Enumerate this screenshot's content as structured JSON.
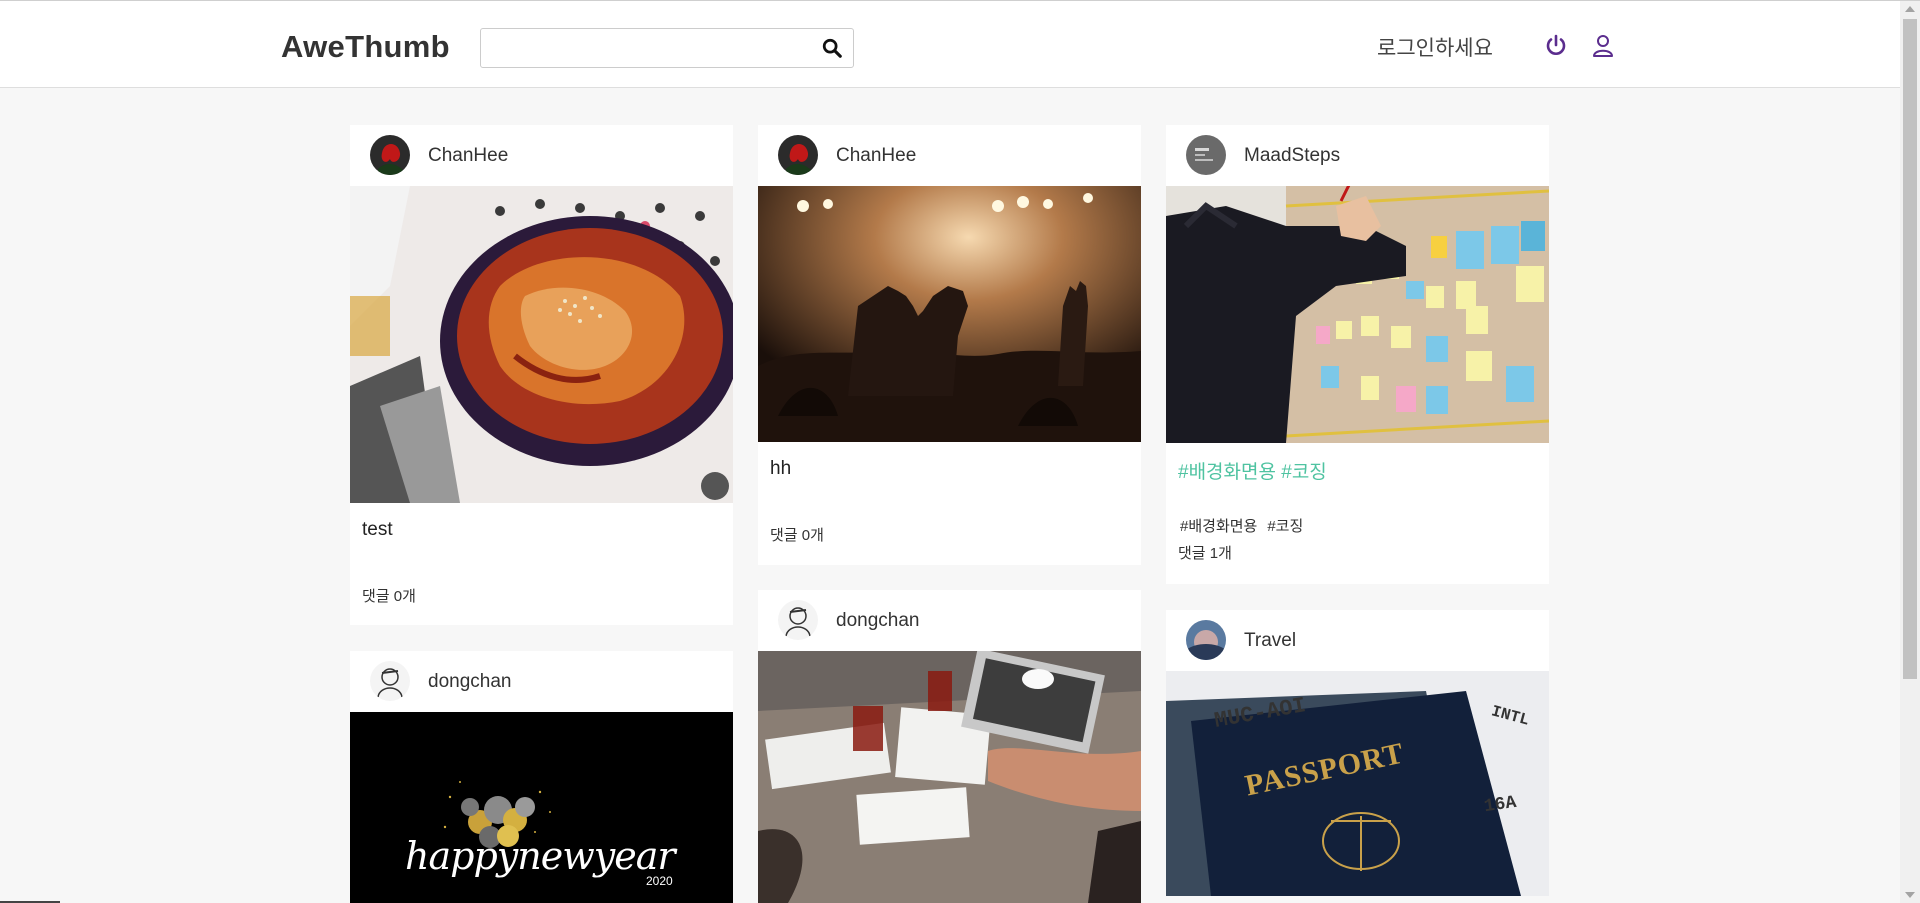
{
  "app": {
    "title": "AweThumb"
  },
  "header": {
    "search": {
      "value": "",
      "placeholder": ""
    },
    "login_text": "로그인하세요",
    "accent": "#5b2d8e"
  },
  "feed": {
    "col1": [
      {
        "username": "ChanHee",
        "caption": "test",
        "tags": [],
        "comments": "댓글 0개",
        "image": "food-bowl"
      },
      {
        "username": "dongchan",
        "caption": "",
        "tags": [],
        "comments": "",
        "image": "happy-new-year-2020",
        "image_text": "happynewyear",
        "image_year": "2020"
      }
    ],
    "col2": [
      {
        "username": "ChanHee",
        "caption": "hh",
        "tags": [],
        "comments": "댓글 0개",
        "image": "concert-crowd"
      },
      {
        "username": "dongchan",
        "caption": "",
        "tags": [],
        "comments": "",
        "image": "cafe-table"
      }
    ],
    "col3": [
      {
        "username": "MaadSteps",
        "caption": "#배경화면용 #코징",
        "tags": [
          "#배경화면용",
          "#코징"
        ],
        "comments": "댓글 1개",
        "image": "sticky-notes-board"
      },
      {
        "username": "Travel",
        "caption": "",
        "tags": [],
        "comments": "",
        "image": "passport-ticket",
        "image_text": "PASSPORT",
        "ticket_code": "MUC-AOI",
        "ticket_class": "INTL",
        "ticket_seat": "16A"
      }
    ]
  },
  "colors": {
    "tag": "#4fc3a1",
    "background": "#f7f7f7"
  }
}
